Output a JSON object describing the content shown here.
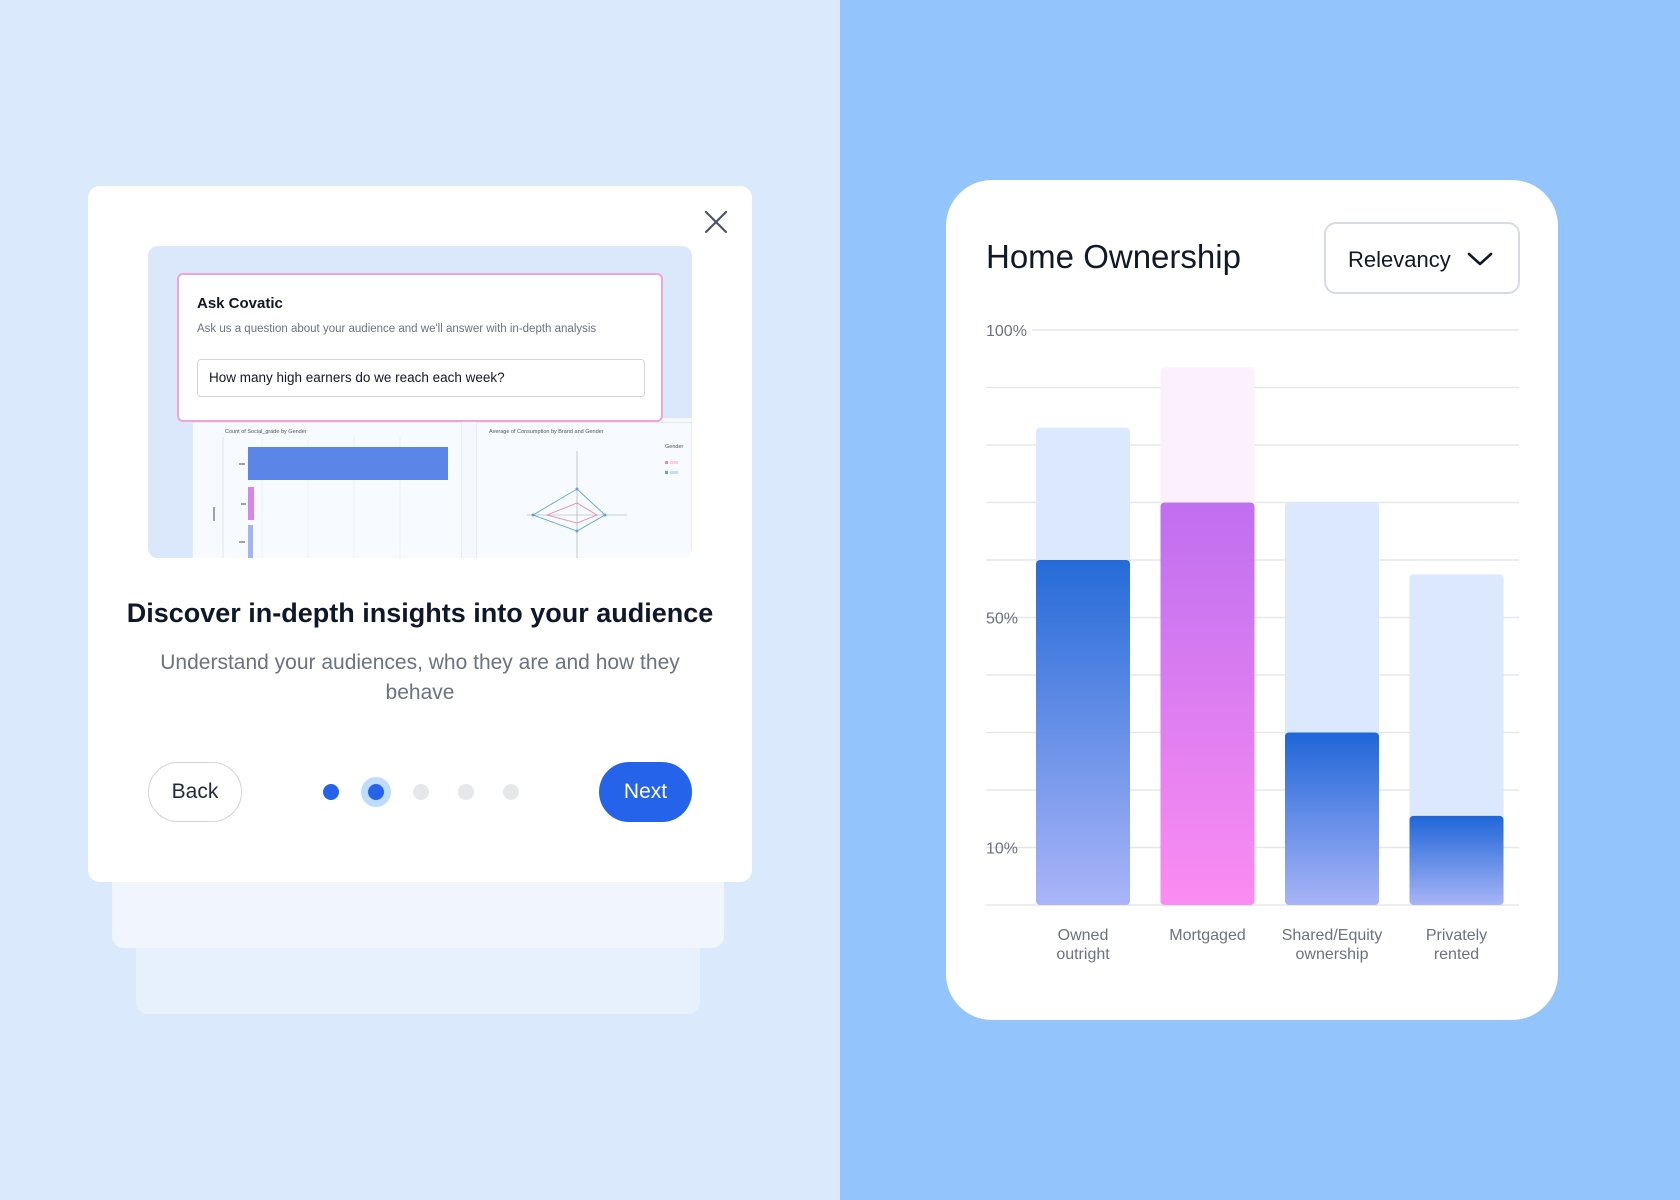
{
  "onboarding": {
    "preview": {
      "ask_title": "Ask Covatic",
      "ask_subtitle": "Ask us a question about your audience and we'll answer with in-depth analysis",
      "ask_input_value": "How many high earners do we reach each week?",
      "panel1_title": "Count of Social_grade by Gender",
      "panel2_title": "Average of Consumption by Brand and Gender",
      "legend_title": "Gender"
    },
    "heading": "Discover in-depth insights into your audience",
    "subtext": "Understand your audiences, who they are and how they behave",
    "back_label": "Back",
    "next_label": "Next",
    "steps": {
      "total": 5,
      "current": 2
    },
    "icons": {
      "close": "close-icon"
    },
    "colors": {
      "accent": "#2563eb",
      "dot_inactive": "#e5e7eb",
      "dot_done": "#2563eb",
      "dot_current_ring": "#bfdbfe"
    }
  },
  "home_ownership": {
    "title": "Home Ownership",
    "dropdown": {
      "selected": "Relevancy",
      "icon": "chevron-down-icon"
    },
    "chart_data": {
      "type": "bar",
      "title": "Home Ownership",
      "categories": [
        "Owned outright",
        "Mortgaged",
        "Shared/Equity ownership",
        "Privately rented"
      ],
      "category_lines": [
        [
          "Owned",
          "outright"
        ],
        [
          "Mortgaged"
        ],
        [
          "Shared/Equity",
          "ownership"
        ],
        [
          "Privately",
          "rented"
        ]
      ],
      "y_tick_labels": [
        "100%",
        "50%",
        "10%"
      ],
      "y_tick_values": [
        100,
        50,
        10
      ],
      "ylim": [
        0,
        100
      ],
      "grid": true,
      "series": [
        {
          "values": [
            60,
            70,
            30,
            15.5
          ],
          "colors": [
            [
              "#256bd8",
              "#aab5f8"
            ],
            [
              "#bf6fef",
              "#fb8cf2"
            ],
            [
              "#1f66d8",
              "#a8b4f7"
            ],
            [
              "#1f66d8",
              "#a8b4f7"
            ]
          ]
        },
        {
          "values": [
            83,
            93.5,
            70,
            57.5
          ],
          "colors": [
            "#dbe8fd",
            "#fdf0fd",
            "#dbe8fd",
            "#dbe8fd"
          ]
        }
      ]
    }
  }
}
